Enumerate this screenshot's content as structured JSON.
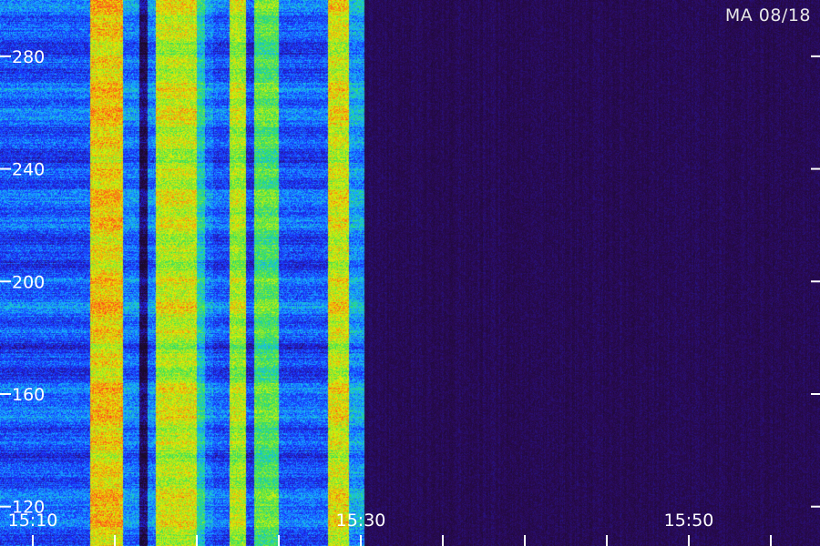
{
  "chart_data": {
    "type": "heatmap",
    "title": "",
    "corner_label": "MA 08/18",
    "ylabel": "",
    "xlabel": "",
    "y_ticks": [
      120,
      160,
      200,
      240,
      280
    ],
    "y_tick_labels": [
      "120",
      "160",
      "200",
      "240",
      "280"
    ],
    "y_range": [
      106,
      300
    ],
    "x_tick_labels": [
      {
        "time": "15:10",
        "label": "15:10"
      },
      {
        "time": "15:30",
        "label": "15:30"
      },
      {
        "time": "15:50",
        "label": "15:50"
      }
    ],
    "x_range": [
      "15:08",
      "15:58"
    ],
    "x_minor_tick_interval_minutes": 5,
    "intensity_bands": [
      {
        "start": "15:08",
        "end": "15:13.5",
        "level": 0.35
      },
      {
        "start": "15:13.5",
        "end": "15:15.5",
        "level": 0.85
      },
      {
        "start": "15:15.5",
        "end": "15:16.5",
        "level": 0.4
      },
      {
        "start": "15:16.5",
        "end": "15:17",
        "level": 0.1
      },
      {
        "start": "15:17",
        "end": "15:17.5",
        "level": 0.4
      },
      {
        "start": "15:17.5",
        "end": "15:20",
        "level": 0.78
      },
      {
        "start": "15:20",
        "end": "15:20.5",
        "level": 0.55
      },
      {
        "start": "15:20.5",
        "end": "15:21",
        "level": 0.4
      },
      {
        "start": "15:21",
        "end": "15:22",
        "level": 0.35
      },
      {
        "start": "15:22",
        "end": "15:23",
        "level": 0.75
      },
      {
        "start": "15:23",
        "end": "15:23.5",
        "level": 0.3
      },
      {
        "start": "15:23.5",
        "end": "15:25",
        "level": 0.65
      },
      {
        "start": "15:25",
        "end": "15:28",
        "level": 0.35
      },
      {
        "start": "15:28",
        "end": "15:29.3",
        "level": 0.8
      },
      {
        "start": "15:29.3",
        "end": "15:30.2",
        "level": 0.45
      },
      {
        "start": "15:30.2",
        "end": "15:58",
        "level": 0.02
      }
    ],
    "colors": {
      "background": "#1a0a2a",
      "low": "#2b0a57",
      "mid": "#1a2cff",
      "cyan": "#16b9ff",
      "green": "#2ee060",
      "yellow": "#e6f000",
      "red": "#ff4420",
      "axis": "#ffffff"
    }
  }
}
